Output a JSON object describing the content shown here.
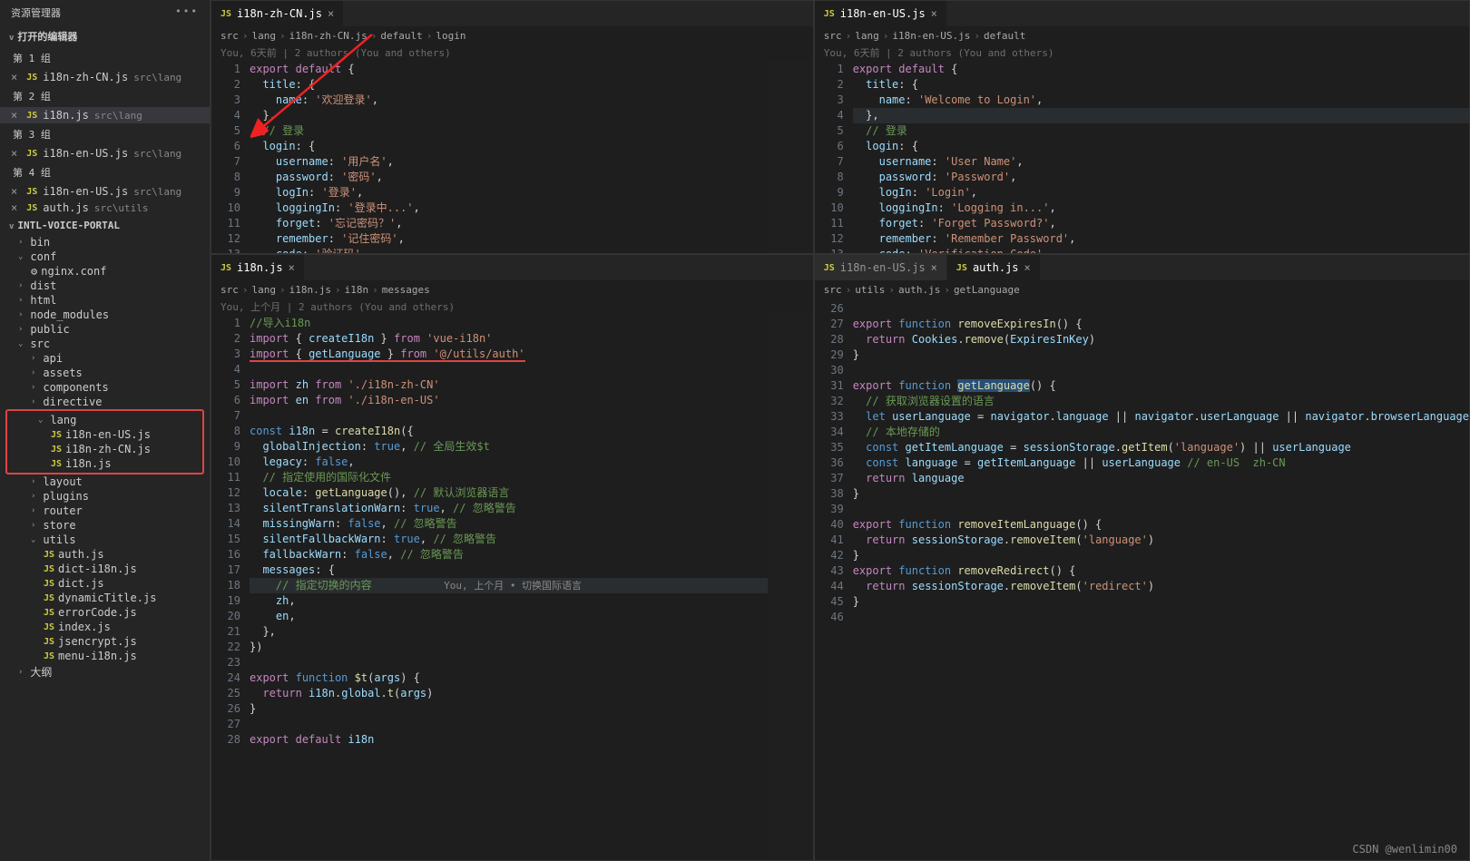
{
  "sidebar": {
    "title": "资源管理器",
    "openEditors": "打开的编辑器",
    "groups": [
      {
        "label": "第 1 组",
        "items": [
          {
            "name": "i18n-zh-CN.js",
            "path": "src\\lang"
          }
        ]
      },
      {
        "label": "第 2 组",
        "items": [
          {
            "name": "i18n.js",
            "path": "src\\lang",
            "active": true
          }
        ]
      },
      {
        "label": "第 3 组",
        "items": [
          {
            "name": "i18n-en-US.js",
            "path": "src\\lang"
          }
        ]
      },
      {
        "label": "第 4 组",
        "items": [
          {
            "name": "i18n-en-US.js",
            "path": "src\\lang"
          },
          {
            "name": "auth.js",
            "path": "src\\utils"
          }
        ]
      }
    ],
    "project": "INTL-VOICE-PORTAL",
    "tree": [
      {
        "label": "bin",
        "chev": ">"
      },
      {
        "label": "conf",
        "chev": "v",
        "children": [
          {
            "label": "nginx.conf",
            "icon": "⚙"
          }
        ]
      },
      {
        "label": "dist",
        "chev": ">"
      },
      {
        "label": "html",
        "chev": ">"
      },
      {
        "label": "node_modules",
        "chev": ">"
      },
      {
        "label": "public",
        "chev": ">"
      },
      {
        "label": "src",
        "chev": "v",
        "children": [
          {
            "label": "api",
            "chev": ">"
          },
          {
            "label": "assets",
            "chev": ">"
          },
          {
            "label": "components",
            "chev": ">"
          },
          {
            "label": "directive",
            "chev": ">"
          },
          {
            "label": "lang",
            "chev": "v",
            "boxed": true,
            "children": [
              {
                "label": "i18n-en-US.js",
                "js": true
              },
              {
                "label": "i18n-zh-CN.js",
                "js": true
              },
              {
                "label": "i18n.js",
                "js": true
              }
            ]
          },
          {
            "label": "layout",
            "chev": ">"
          },
          {
            "label": "plugins",
            "chev": ">"
          },
          {
            "label": "router",
            "chev": ">"
          },
          {
            "label": "store",
            "chev": ">"
          },
          {
            "label": "utils",
            "chev": "v",
            "children": [
              {
                "label": "auth.js",
                "js": true
              },
              {
                "label": "dict-i18n.js",
                "js": true
              },
              {
                "label": "dict.js",
                "js": true
              },
              {
                "label": "dynamicTitle.js",
                "js": true
              },
              {
                "label": "errorCode.js",
                "js": true
              },
              {
                "label": "index.js",
                "js": true
              },
              {
                "label": "jsencrypt.js",
                "js": true
              },
              {
                "label": "menu-i18n.js",
                "js": true
              }
            ]
          }
        ]
      },
      {
        "label": "大纲",
        "chev": ">"
      }
    ]
  },
  "pane_tl": {
    "tab": "i18n-zh-CN.js",
    "crumbs": [
      "src",
      "lang",
      "i18n-zh-CN.js",
      "default",
      "login"
    ],
    "blame": "You, 6天前 | 2 authors (You and others)",
    "code": [
      {
        "n": 1,
        "raw": "<span class='k-pink'>export</span> <span class='k-pink'>default</span> <span class='k-pun'>{</span>"
      },
      {
        "n": 2,
        "raw": "  <span class='k-lblue'>title</span><span class='k-pun'>: {</span>"
      },
      {
        "n": 3,
        "raw": "    <span class='k-lblue'>name</span><span class='k-pun'>:</span> <span class='k-str'>'欢迎登录'</span><span class='k-pun'>,</span>"
      },
      {
        "n": 4,
        "raw": "  <span class='k-pun'>},</span>"
      },
      {
        "n": 5,
        "raw": "  <span class='k-cmt'>// 登录</span>"
      },
      {
        "n": 6,
        "raw": "  <span class='k-lblue'>login</span><span class='k-pun'>: {</span>"
      },
      {
        "n": 7,
        "raw": "    <span class='k-lblue'>username</span><span class='k-pun'>:</span> <span class='k-str'>'用户名'</span><span class='k-pun'>,</span>"
      },
      {
        "n": 8,
        "raw": "    <span class='k-lblue'>password</span><span class='k-pun'>:</span> <span class='k-str'>'密码'</span><span class='k-pun'>,</span>"
      },
      {
        "n": 9,
        "raw": "    <span class='k-lblue'>logIn</span><span class='k-pun'>:</span> <span class='k-str'>'登录'</span><span class='k-pun'>,</span>"
      },
      {
        "n": 10,
        "raw": "    <span class='k-lblue'>loggingIn</span><span class='k-pun'>:</span> <span class='k-str'>'登录中...'</span><span class='k-pun'>,</span>"
      },
      {
        "n": 11,
        "raw": "    <span class='k-lblue'>forget</span><span class='k-pun'>:</span> <span class='k-str'>'忘记密码？'</span><span class='k-pun'>,</span>"
      },
      {
        "n": 12,
        "raw": "    <span class='k-lblue'>remember</span><span class='k-pun'>:</span> <span class='k-str'>'记住密码'</span><span class='k-pun'>,</span>"
      },
      {
        "n": 13,
        "raw": "    <span class='k-lblue'>code</span><span class='k-pun'>:</span> <span class='k-str'>'验证码'</span><span class='k-pun'>,</span>"
      }
    ]
  },
  "pane_tr": {
    "tab": "i18n-en-US.js",
    "crumbs": [
      "src",
      "lang",
      "i18n-en-US.js",
      "default"
    ],
    "blame": "You, 6天前 | 2 authors (You and others)",
    "code": [
      {
        "n": 1,
        "raw": "<span class='k-pink'>export</span> <span class='k-pink'>default</span> <span class='k-pun'>{</span>"
      },
      {
        "n": 2,
        "raw": "  <span class='k-lblue'>title</span><span class='k-pun'>: {</span>"
      },
      {
        "n": 3,
        "raw": "    <span class='k-lblue'>name</span><span class='k-pun'>:</span> <span class='k-str'>'Welcome to Login'</span><span class='k-pun'>,</span>"
      },
      {
        "n": 4,
        "raw": "  <span class='k-pun'>},</span>",
        "hl": true
      },
      {
        "n": 5,
        "raw": "  <span class='k-cmt'>// 登录</span>"
      },
      {
        "n": 6,
        "raw": "  <span class='k-lblue'>login</span><span class='k-pun'>: {</span>"
      },
      {
        "n": 7,
        "raw": "    <span class='k-lblue'>username</span><span class='k-pun'>:</span> <span class='k-str'>'User Name'</span><span class='k-pun'>,</span>"
      },
      {
        "n": 8,
        "raw": "    <span class='k-lblue'>password</span><span class='k-pun'>:</span> <span class='k-str'>'Password'</span><span class='k-pun'>,</span>"
      },
      {
        "n": 9,
        "raw": "    <span class='k-lblue'>logIn</span><span class='k-pun'>:</span> <span class='k-str'>'Login'</span><span class='k-pun'>,</span>"
      },
      {
        "n": 10,
        "raw": "    <span class='k-lblue'>loggingIn</span><span class='k-pun'>:</span> <span class='k-str'>'Logging in...'</span><span class='k-pun'>,</span>"
      },
      {
        "n": 11,
        "raw": "    <span class='k-lblue'>forget</span><span class='k-pun'>:</span> <span class='k-str'>'Forget Password?'</span><span class='k-pun'>,</span>"
      },
      {
        "n": 12,
        "raw": "    <span class='k-lblue'>remember</span><span class='k-pun'>:</span> <span class='k-str'>'Remember Password'</span><span class='k-pun'>,</span>"
      },
      {
        "n": 13,
        "raw": "    <span class='k-lblue'>code</span><span class='k-pun'>:</span> <span class='k-str'>'Verification Code'</span><span class='k-pun'>,</span>"
      }
    ]
  },
  "pane_bl": {
    "tab": "i18n.js",
    "crumbs": [
      "src",
      "lang",
      "i18n.js",
      "i18n",
      "messages"
    ],
    "blame": "You, 上个月 | 2 authors (You and others)",
    "code": [
      {
        "n": 1,
        "raw": "<span class='k-cmt'>//导入i18n</span>"
      },
      {
        "n": 2,
        "raw": "<span class='k-pink'>import</span> <span class='k-pun'>{</span> <span class='k-lblue'>createI18n</span> <span class='k-pun'>}</span> <span class='k-pink'>from</span> <span class='k-str'>'vue-i18n'</span>"
      },
      {
        "n": 3,
        "raw": "<span class='underline-red'><span class='k-pink'>import</span> <span class='k-pun'>{</span> <span class='k-lblue'>getLanguage</span> <span class='k-pun'>}</span> <span class='k-pink'>from</span> <span class='k-str'>'@/utils/auth'</span></span>"
      },
      {
        "n": 4,
        "raw": ""
      },
      {
        "n": 5,
        "raw": "<span class='k-pink'>import</span> <span class='k-lblue'>zh</span> <span class='k-pink'>from</span> <span class='k-str'>'./i18n-zh-CN'</span>"
      },
      {
        "n": 6,
        "raw": "<span class='k-pink'>import</span> <span class='k-lblue'>en</span> <span class='k-pink'>from</span> <span class='k-str'>'./i18n-en-US'</span>"
      },
      {
        "n": 7,
        "raw": ""
      },
      {
        "n": 8,
        "raw": "<span class='k-blue'>const</span> <span class='k-lblue'>i18n</span> <span class='k-pun'>=</span> <span class='k-yel'>createI18n</span><span class='k-pun'>({</span>"
      },
      {
        "n": 9,
        "raw": "  <span class='k-lblue'>globalInjection</span><span class='k-pun'>:</span> <span class='k-blue'>true</span><span class='k-pun'>,</span> <span class='k-cmt'>// 全局生效$t</span>"
      },
      {
        "n": 10,
        "raw": "  <span class='k-lblue'>legacy</span><span class='k-pun'>:</span> <span class='k-blue'>false</span><span class='k-pun'>,</span>"
      },
      {
        "n": 11,
        "raw": "  <span class='k-cmt'>// 指定使用的国际化文件</span>"
      },
      {
        "n": 12,
        "raw": "  <span class='k-lblue'>locale</span><span class='k-pun'>:</span> <span class='k-yel'>getLanguage</span><span class='k-pun'>(),</span> <span class='k-cmt'>// 默认浏览器语言</span>"
      },
      {
        "n": 13,
        "raw": "  <span class='k-lblue'>silentTranslationWarn</span><span class='k-pun'>:</span> <span class='k-blue'>true</span><span class='k-pun'>,</span> <span class='k-cmt'>// 忽略警告</span>"
      },
      {
        "n": 14,
        "raw": "  <span class='k-lblue'>missingWarn</span><span class='k-pun'>:</span> <span class='k-blue'>false</span><span class='k-pun'>,</span> <span class='k-cmt'>// 忽略警告</span>"
      },
      {
        "n": 15,
        "raw": "  <span class='k-lblue'>silentFallbackWarn</span><span class='k-pun'>:</span> <span class='k-blue'>true</span><span class='k-pun'>,</span> <span class='k-cmt'>// 忽略警告</span>"
      },
      {
        "n": 16,
        "raw": "  <span class='k-lblue'>fallbackWarn</span><span class='k-pun'>:</span> <span class='k-blue'>false</span><span class='k-pun'>,</span> <span class='k-cmt'>// 忽略警告</span>"
      },
      {
        "n": 17,
        "raw": "  <span class='k-lblue'>messages</span><span class='k-pun'>:</span> <span class='k-pun'>{</span>"
      },
      {
        "n": 18,
        "raw": "    <span class='k-cmt'>// 指定切换的内容</span>           <span class='dim'>You, 上个月 • 切换国际语言</span>",
        "hl": true
      },
      {
        "n": 19,
        "raw": "    <span class='k-lblue'>zh</span><span class='k-pun'>,</span>"
      },
      {
        "n": 20,
        "raw": "    <span class='k-lblue'>en</span><span class='k-pun'>,</span>"
      },
      {
        "n": 21,
        "raw": "  <span class='k-pun'>},</span>"
      },
      {
        "n": 22,
        "raw": "<span class='k-pun'>})</span>"
      },
      {
        "n": 23,
        "raw": ""
      },
      {
        "n": 24,
        "raw": "<span class='k-pink'>export</span> <span class='k-blue'>function</span> <span class='k-yel'>$t</span><span class='k-pun'>(</span><span class='k-lblue'>args</span><span class='k-pun'>) {</span>"
      },
      {
        "n": 25,
        "raw": "  <span class='k-pink'>return</span> <span class='k-lblue'>i18n</span><span class='k-pun'>.</span><span class='k-lblue'>global</span><span class='k-pun'>.</span><span class='k-yel'>t</span><span class='k-pun'>(</span><span class='k-lblue'>args</span><span class='k-pun'>)</span>"
      },
      {
        "n": 26,
        "raw": "<span class='k-pun'>}</span>"
      },
      {
        "n": 27,
        "raw": ""
      },
      {
        "n": 28,
        "raw": "<span class='k-pink'>export</span> <span class='k-pink'>default</span> <span class='k-lblue'>i18n</span>"
      }
    ]
  },
  "pane_br": {
    "tabs": [
      {
        "label": "i18n-en-US.js",
        "active": false
      },
      {
        "label": "auth.js",
        "active": true
      }
    ],
    "crumbs": [
      "src",
      "utils",
      "auth.js",
      "getLanguage"
    ],
    "code": [
      {
        "n": 26,
        "raw": ""
      },
      {
        "n": 27,
        "raw": "<span class='k-pink'>export</span> <span class='k-blue'>function</span> <span class='k-yel'>removeExpiresIn</span><span class='k-pun'>() {</span>"
      },
      {
        "n": 28,
        "raw": "  <span class='k-pink'>return</span> <span class='k-lblue'>Cookies</span><span class='k-pun'>.</span><span class='k-yel'>remove</span><span class='k-pun'>(</span><span class='k-lblue'>ExpiresInKey</span><span class='k-pun'>)</span>"
      },
      {
        "n": 29,
        "raw": "<span class='k-pun'>}</span>"
      },
      {
        "n": 30,
        "raw": ""
      },
      {
        "n": 31,
        "raw": "<span class='k-pink'>export</span> <span class='k-blue'>function</span> <span class='k-yel sel'>getLanguage</span><span class='k-pun'>() {</span>"
      },
      {
        "n": 32,
        "raw": "  <span class='k-cmt'>// 获取浏览器设置的语言</span>"
      },
      {
        "n": 33,
        "raw": "  <span class='k-blue'>let</span> <span class='k-lblue'>userLanguage</span> <span class='k-pun'>=</span> <span class='k-lblue'>navigator</span><span class='k-pun'>.</span><span class='k-lblue'>language</span> <span class='k-pun'>||</span> <span class='k-lblue'>navigator</span><span class='k-pun'>.</span><span class='k-lblue'>userLanguage</span> <span class='k-pun'>||</span> <span class='k-lblue'>navigator</span><span class='k-pun'>.</span><span class='k-lblue'>browserLanguage</span>"
      },
      {
        "n": 34,
        "raw": "  <span class='k-cmt'>// 本地存储的</span>"
      },
      {
        "n": 35,
        "raw": "  <span class='k-blue'>const</span> <span class='k-lblue'>getItemLanguage</span> <span class='k-pun'>=</span> <span class='k-lblue'>sessionStorage</span><span class='k-pun'>.</span><span class='k-yel'>getItem</span><span class='k-pun'>(</span><span class='k-str'>'language'</span><span class='k-pun'>)</span> <span class='k-pun'>||</span> <span class='k-lblue'>userLanguage</span>"
      },
      {
        "n": 36,
        "raw": "  <span class='k-blue'>const</span> <span class='k-lblue'>language</span> <span class='k-pun'>=</span> <span class='k-lblue'>getItemLanguage</span> <span class='k-pun'>||</span> <span class='k-lblue'>userLanguage</span> <span class='k-cmt'>// en-US  zh-CN</span>"
      },
      {
        "n": 37,
        "raw": "  <span class='k-pink'>return</span> <span class='k-lblue'>language</span>"
      },
      {
        "n": 38,
        "raw": "<span class='k-pun'>}</span>"
      },
      {
        "n": 39,
        "raw": ""
      },
      {
        "n": 40,
        "raw": "<span class='k-pink'>export</span> <span class='k-blue'>function</span> <span class='k-yel'>removeItemLanguage</span><span class='k-pun'>() {</span>"
      },
      {
        "n": 41,
        "raw": "  <span class='k-pink'>return</span> <span class='k-lblue'>sessionStorage</span><span class='k-pun'>.</span><span class='k-yel'>removeItem</span><span class='k-pun'>(</span><span class='k-str'>'language'</span><span class='k-pun'>)</span>"
      },
      {
        "n": 42,
        "raw": "<span class='k-pun'>}</span>"
      },
      {
        "n": 43,
        "raw": "<span class='k-pink'>export</span> <span class='k-blue'>function</span> <span class='k-yel'>removeRedirect</span><span class='k-pun'>() {</span>"
      },
      {
        "n": 44,
        "raw": "  <span class='k-pink'>return</span> <span class='k-lblue'>sessionStorage</span><span class='k-pun'>.</span><span class='k-yel'>removeItem</span><span class='k-pun'>(</span><span class='k-str'>'redirect'</span><span class='k-pun'>)</span>"
      },
      {
        "n": 45,
        "raw": "<span class='k-pun'>}</span>"
      },
      {
        "n": 46,
        "raw": ""
      }
    ]
  },
  "watermark": "CSDN @wenlimin00"
}
